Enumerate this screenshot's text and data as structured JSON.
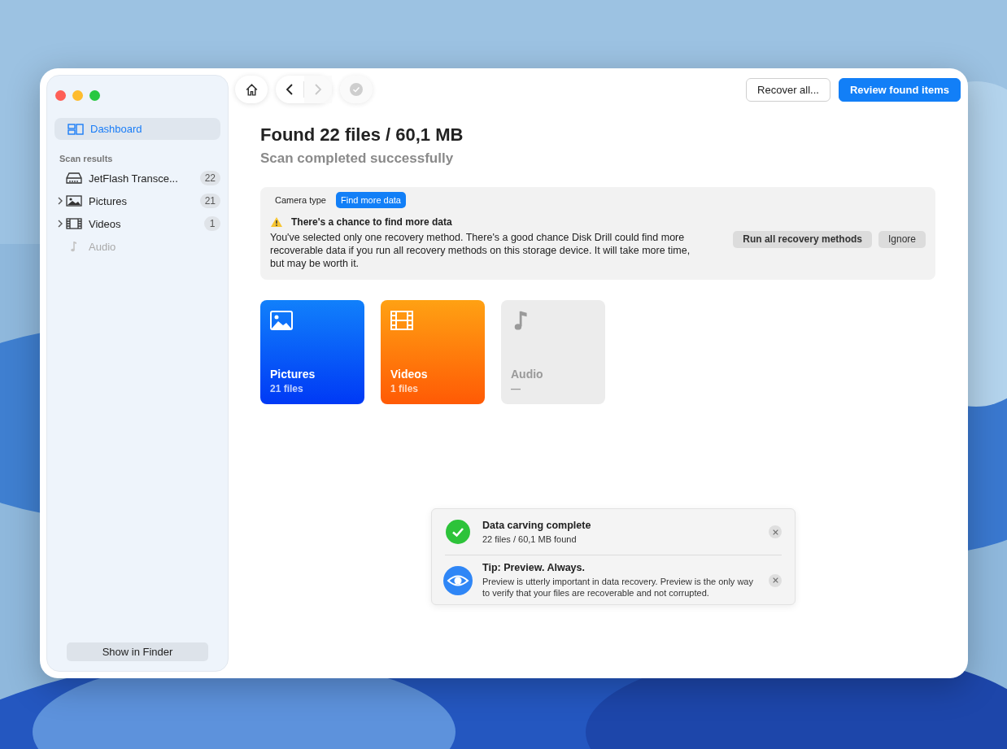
{
  "sidebar": {
    "items": [
      {
        "kind": "dashboard",
        "label": "Dashboard",
        "selected": true
      }
    ],
    "section_title": "Scan results",
    "results": [
      {
        "kind": "drive",
        "label": "JetFlash Transce...",
        "count": "22",
        "expandable": false,
        "disabled": false
      },
      {
        "kind": "pictures",
        "label": "Pictures",
        "count": "21",
        "expandable": true,
        "disabled": false
      },
      {
        "kind": "videos",
        "label": "Videos",
        "count": "1",
        "expandable": true,
        "disabled": false
      },
      {
        "kind": "audio",
        "label": "Audio",
        "expandable": false,
        "disabled": true
      }
    ],
    "footer_button": "Show in Finder"
  },
  "toolbar": [
    {
      "kind": "home",
      "disabled": false
    },
    {
      "kind": "back",
      "disabled": false
    },
    {
      "kind": "forward",
      "disabled": true
    },
    {
      "kind": "check",
      "disabled": true
    }
  ],
  "actions": [
    {
      "label": "Recover all...",
      "primary": false
    },
    {
      "label": "Review found items",
      "primary": true
    }
  ],
  "title": "Found 22 files / 60,1 MB",
  "subtitle": "Scan completed successfully",
  "panel": {
    "tabs": [
      {
        "label": "Camera type",
        "selected": false
      },
      {
        "label": "Find more data",
        "selected": true
      }
    ],
    "heading": "There's a chance to find more data",
    "text": "You've selected only one recovery method. There's a good chance Disk Drill could find more recoverable data if you run all recovery methods on this storage device. It will take more time, but may be worth it.",
    "buttons": [
      "Run all recovery methods",
      "Ignore"
    ]
  },
  "cards": [
    {
      "kind": "pictures",
      "label": "Pictures",
      "count": "21 files",
      "disabled": false
    },
    {
      "kind": "videos",
      "label": "Videos",
      "count": "1 files",
      "disabled": false
    },
    {
      "kind": "audio",
      "label": "Audio",
      "count": "—",
      "disabled": true
    }
  ],
  "notifications": [
    {
      "kind": "success",
      "title": "Data carving complete",
      "text": "22 files / 60,1 MB found"
    },
    {
      "kind": "tip",
      "title": "Tip: Preview. Always.",
      "text": "Preview is utterly important in data recovery. Preview is the only way to verify that your files are recoverable and not corrupted."
    }
  ]
}
